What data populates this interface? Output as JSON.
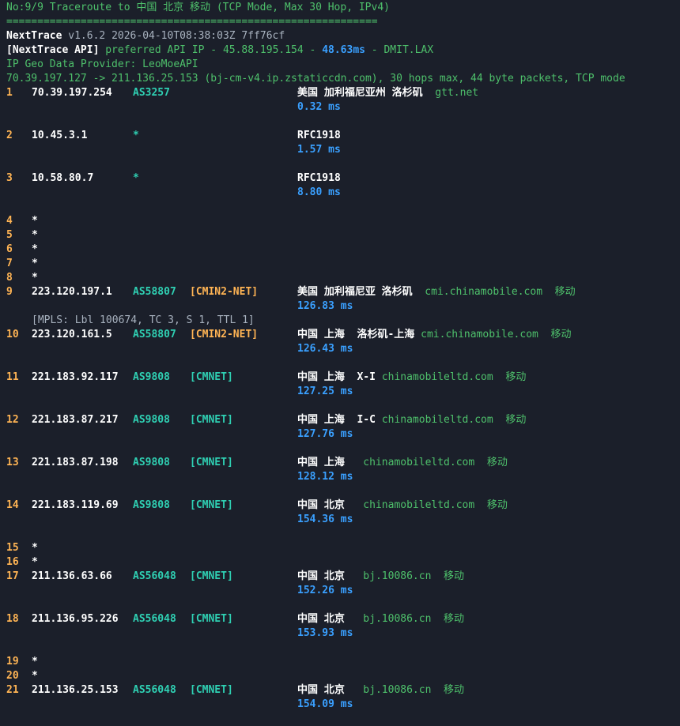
{
  "header": {
    "title": "No:9/9 Traceroute to 中国 北京 移动 (TCP Mode, Max 30 Hop, IPv4)",
    "separator": "============================================================",
    "app_name": "NextTrace",
    "version_line": " v1.6.2 2026-04-10T08:38:03Z 7ff76cf",
    "api_label": "[NextTrace API]",
    "api_pref": " preferred API IP - ",
    "api_ip": "45.88.195.154",
    "api_sep": " - ",
    "api_latency": "48.63ms",
    "api_node": " - DMIT.LAX",
    "geo_provider": "IP Geo Data Provider: LeoMoeAPI",
    "route_line": "70.39.197.127 -> 211.136.25.153 (bj-cm-v4.ip.zstaticcdn.com), 30 hops max, 44 byte packets, TCP mode"
  },
  "hops": [
    {
      "num": "1",
      "ip": "70.39.197.254",
      "as": "AS3257",
      "tag": "",
      "tag_color": "",
      "geo": "美国 加利福尼亚州 洛杉矶",
      "host": "  gtt.net",
      "isp": "",
      "rtt": "0.32 ms"
    },
    {
      "num": "2",
      "ip": "10.45.3.1",
      "as": "*",
      "tag": "",
      "tag_color": "",
      "geo": "RFC1918",
      "host": "",
      "isp": "",
      "rtt": "1.57 ms"
    },
    {
      "num": "3",
      "ip": "10.58.80.7",
      "as": "*",
      "tag": "",
      "tag_color": "",
      "geo": "RFC1918",
      "host": "",
      "isp": "",
      "rtt": "8.80 ms"
    },
    {
      "num": "4",
      "star": "*"
    },
    {
      "num": "5",
      "star": "*"
    },
    {
      "num": "6",
      "star": "*"
    },
    {
      "num": "7",
      "star": "*"
    },
    {
      "num": "8",
      "star": "*"
    },
    {
      "num": "9",
      "ip": "223.120.197.1",
      "as": "AS58807",
      "tag": "[CMIN2-NET]",
      "tag_color": "orange",
      "geo": "美国 加利福尼亚 洛杉矶",
      "host": "  cmi.chinamobile.com",
      "isp": "  移动",
      "rtt": "126.83 ms",
      "mpls": "[MPLS: Lbl 100674, TC 3, S 1, TTL 1]"
    },
    {
      "num": "10",
      "ip": "223.120.161.5",
      "as": "AS58807",
      "tag": "[CMIN2-NET]",
      "tag_color": "orange",
      "geo": "中国 上海  洛杉矶-上海",
      "host": " cmi.chinamobile.com",
      "isp": "  移动",
      "rtt": "126.43 ms"
    },
    {
      "num": "11",
      "ip": "221.183.92.117",
      "as": "AS9808",
      "tag": "[CMNET]",
      "tag_color": "cyan",
      "geo": "中国 上海  X-I",
      "host": " chinamobileltd.com",
      "isp": "  移动",
      "rtt": "127.25 ms"
    },
    {
      "num": "12",
      "ip": "221.183.87.217",
      "as": "AS9808",
      "tag": "[CMNET]",
      "tag_color": "cyan",
      "geo": "中国 上海  I-C",
      "host": " chinamobileltd.com",
      "isp": "  移动",
      "rtt": "127.76 ms"
    },
    {
      "num": "13",
      "ip": "221.183.87.198",
      "as": "AS9808",
      "tag": "[CMNET]",
      "tag_color": "cyan",
      "geo": "中国 上海",
      "host": "   chinamobileltd.com",
      "isp": "  移动",
      "rtt": "128.12 ms"
    },
    {
      "num": "14",
      "ip": "221.183.119.69",
      "as": "AS9808",
      "tag": "[CMNET]",
      "tag_color": "cyan",
      "geo": "中国 北京",
      "host": "   chinamobileltd.com",
      "isp": "  移动",
      "rtt": "154.36 ms"
    },
    {
      "num": "15",
      "star": "*"
    },
    {
      "num": "16",
      "star": "*"
    },
    {
      "num": "17",
      "ip": "211.136.63.66",
      "as": "AS56048",
      "tag": "[CMNET]",
      "tag_color": "cyan",
      "geo": "中国 北京",
      "host": "   bj.10086.cn",
      "isp": "  移动",
      "rtt": "152.26 ms"
    },
    {
      "num": "18",
      "ip": "211.136.95.226",
      "as": "AS56048",
      "tag": "[CMNET]",
      "tag_color": "cyan",
      "geo": "中国 北京",
      "host": "   bj.10086.cn",
      "isp": "  移动",
      "rtt": "153.93 ms"
    },
    {
      "num": "19",
      "star": "*"
    },
    {
      "num": "20",
      "star": "*"
    },
    {
      "num": "21",
      "ip": "211.136.25.153",
      "as": "AS56048",
      "tag": "[CMNET]",
      "tag_color": "cyan",
      "geo": "中国 北京",
      "host": "   bj.10086.cn",
      "isp": "  移动",
      "rtt": "154.09 ms"
    }
  ]
}
